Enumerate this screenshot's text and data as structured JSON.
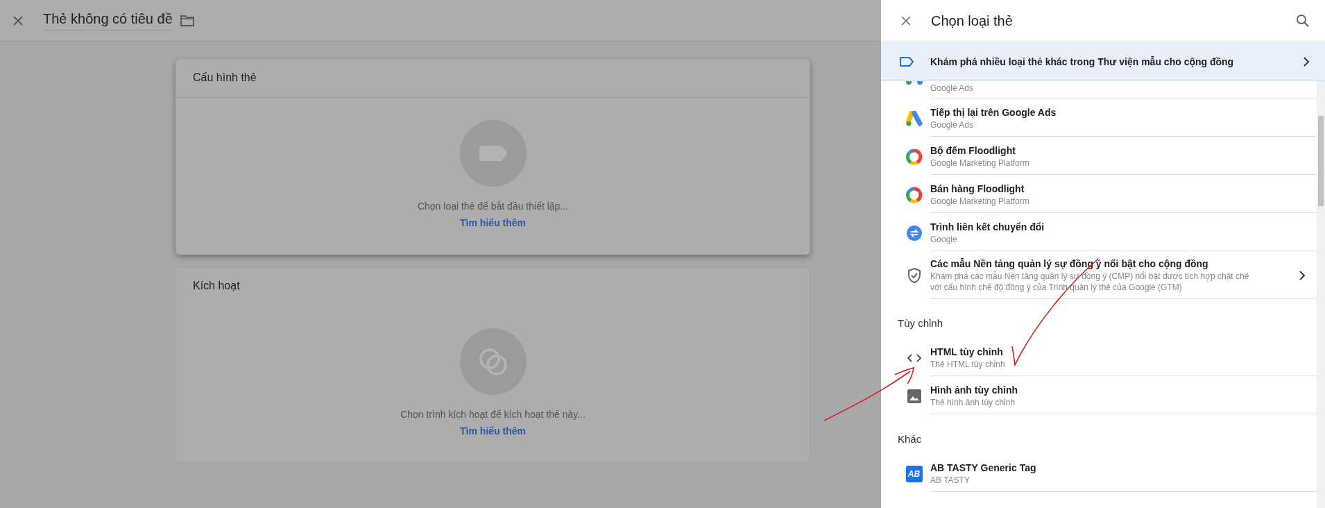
{
  "topbar": {
    "title": "Thẻ không có tiêu đề"
  },
  "cards": [
    {
      "kind": "tag",
      "active": true,
      "title": "Cấu hình thẻ",
      "prompt": "Chọn loại thẻ để bắt đầu thiết lập...",
      "link": "Tìm hiểu thêm"
    },
    {
      "kind": "trigger",
      "active": false,
      "title": "Kích hoạt",
      "prompt": "Chọn trình kích hoạt để kích hoạt thẻ này...",
      "link": "Tìm hiểu thêm"
    }
  ],
  "panel": {
    "title": "Chọn loại thẻ",
    "banner": "Khám phá nhiều loại thẻ khác trong Thư viện mẫu cho cộng đồng",
    "groups": [
      {
        "items": [
          {
            "kind": "dots",
            "subtitle": "Google Ads"
          },
          {
            "kind": "ads",
            "title": "Tiếp thị lại trên Google Ads",
            "subtitle": "Google Ads"
          },
          {
            "kind": "floodlight",
            "title": "Bộ đếm Floodlight",
            "subtitle": "Google Marketing Platform"
          },
          {
            "kind": "floodlight",
            "title": "Bán hàng Floodlight",
            "subtitle": "Google Marketing Platform"
          },
          {
            "kind": "convert",
            "title": "Trình liên kết chuyển đổi",
            "subtitle": "Google"
          },
          {
            "kind": "shield",
            "title": "Các mẫu Nền tảng quản lý sự đồng ý nổi bật cho cộng đồng",
            "subtitle": "Khám phá các mẫu Nền tảng quản lý sự đồng ý (CMP) nổi bật được tích hợp chặt chẽ với cấu hình chế độ đồng ý của Trình quản lý thẻ của Google (GTM)",
            "chevron": true
          }
        ]
      },
      {
        "heading": "Tùy chỉnh",
        "items": [
          {
            "kind": "code",
            "title": "HTML tùy chỉnh",
            "subtitle": "Thẻ HTML tùy chỉnh"
          },
          {
            "kind": "image",
            "title": "Hình ảnh tùy chỉnh",
            "subtitle": "Thẻ hình ảnh tùy chỉnh"
          }
        ]
      },
      {
        "heading": "Khác",
        "items": [
          {
            "kind": "abtasty",
            "icon_text": "AB",
            "title": "AB TASTY Generic Tag",
            "subtitle": "AB TASTY"
          }
        ]
      }
    ]
  }
}
